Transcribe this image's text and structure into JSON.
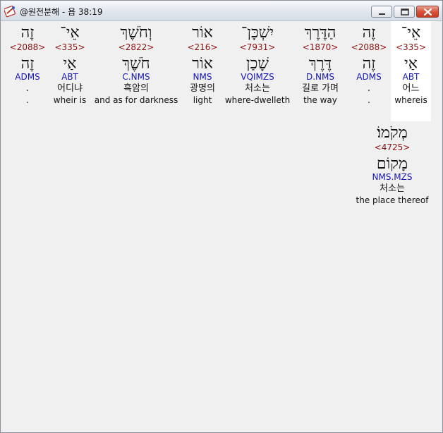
{
  "window": {
    "title": "@원전분해 - 욥 38:19",
    "icon": "app-book-icon",
    "buttons": [
      "minimize-icon",
      "maximize-icon",
      "close-icon"
    ],
    "close_color": "#d44a32"
  },
  "colors": {
    "strong": "#8b1010",
    "morph": "#1414b4",
    "text": "#111111",
    "selected_bg": "#ffffff"
  },
  "words": [
    {
      "hebrew": "זֶה",
      "strong": "<2088>",
      "lemma": "זֶה",
      "morph": "ADMS",
      "korean": ".",
      "english": "."
    },
    {
      "hebrew": "אֵי־",
      "strong": "<335>",
      "lemma": "אַי",
      "morph": "ABT",
      "korean": "어디냐",
      "english": "wheir is"
    },
    {
      "hebrew": "וְחֹשֶׁךְ",
      "strong": "<2822>",
      "lemma": "חֹשֶׁךְ",
      "morph": "C.NMS",
      "korean": "흑암의",
      "english": "and as for darkness"
    },
    {
      "hebrew": "אוֹר",
      "strong": "<216>",
      "lemma": "אוֹר",
      "morph": "NMS",
      "korean": "광명의",
      "english": "light"
    },
    {
      "hebrew": "יִשְׁכָּן־",
      "strong": "<7931>",
      "lemma": "שָׁכַן",
      "morph": "VQIMZS",
      "korean": "처소는",
      "english": "where-dwelleth"
    },
    {
      "hebrew": "הַדֶּרֶךְ",
      "strong": "<1870>",
      "lemma": "דֶּרֶךְ",
      "morph": "D.NMS",
      "korean": "길로 가며",
      "english": "the way"
    },
    {
      "hebrew": "זֶה",
      "strong": "<2088>",
      "lemma": "זֶה",
      "morph": "ADMS",
      "korean": ".",
      "english": "."
    },
    {
      "hebrew": "אֵי־",
      "strong": "<335>",
      "lemma": "אַי",
      "morph": "ABT",
      "korean": "어느",
      "english": "whereis",
      "selected": true
    },
    {
      "hebrew": "מְקֹמוֹ׃",
      "strong": "<4725>",
      "lemma": "מָקוֹם",
      "morph": "NMS.MZS",
      "korean": "처소는",
      "english": "the place thereof"
    }
  ]
}
